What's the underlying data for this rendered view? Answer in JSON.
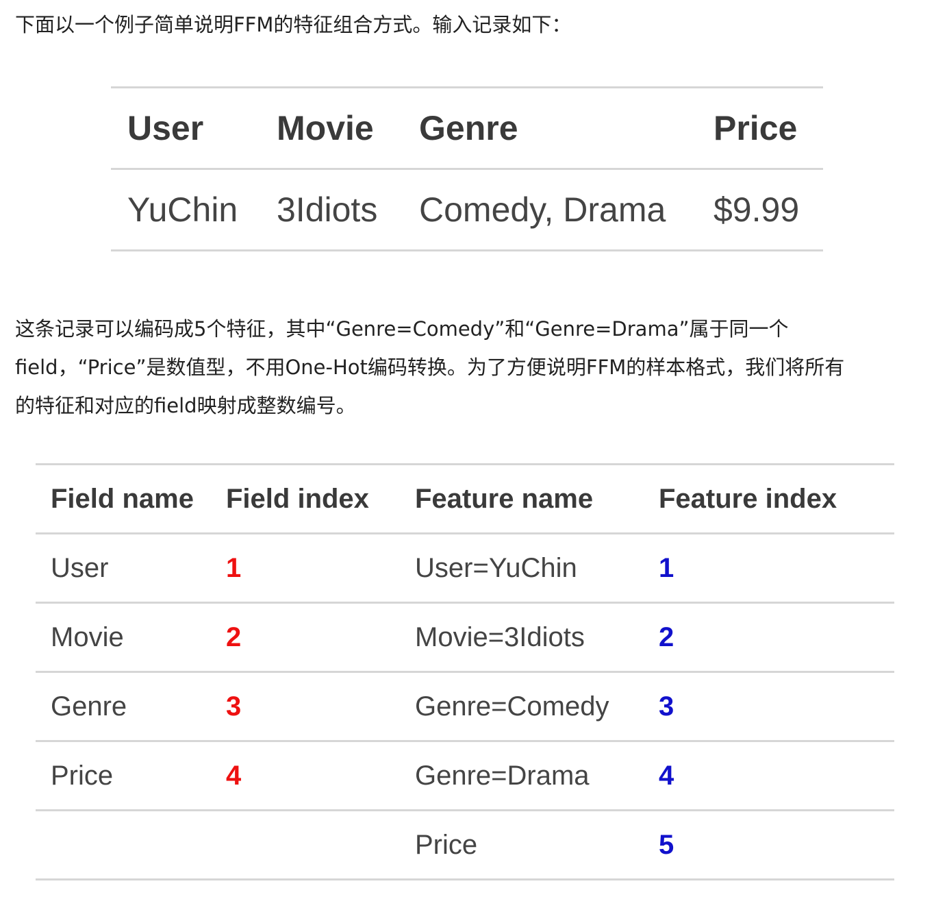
{
  "intro_text": "下面以一个例子简单说明FFM的特征组合方式。输入记录如下：",
  "record_table": {
    "headers": [
      "User",
      "Movie",
      "Genre",
      "Price"
    ],
    "row": [
      "YuChin",
      "3Idiots",
      "Comedy, Drama",
      "$9.99"
    ]
  },
  "explanation_lines": [
    "这条记录可以编码成5个特征，其中“Genre=Comedy”和“Genre=Drama”属于同一个",
    "field，“Price”是数值型，不用One-Hot编码转换。为了方便说明FFM的样本格式，我们将所有",
    "的特征和对应的field映射成整数编号。"
  ],
  "mapping_table": {
    "headers": [
      "Field name",
      "Field index",
      "Feature name",
      "Feature index"
    ],
    "rows": [
      {
        "field_name": "User",
        "field_index": "1",
        "feature_name": "User=YuChin",
        "feature_index": "1"
      },
      {
        "field_name": "Movie",
        "field_index": "2",
        "feature_name": "Movie=3Idiots",
        "feature_index": "2"
      },
      {
        "field_name": "Genre",
        "field_index": "3",
        "feature_name": "Genre=Comedy",
        "feature_index": "3"
      },
      {
        "field_name": "Price",
        "field_index": "4",
        "feature_name": "Genre=Drama",
        "feature_index": "4"
      },
      {
        "field_name": "",
        "field_index": "",
        "feature_name": "Price",
        "feature_index": "5"
      }
    ],
    "field_index_color": "#ee1111",
    "feature_index_color": "#1111cc"
  }
}
